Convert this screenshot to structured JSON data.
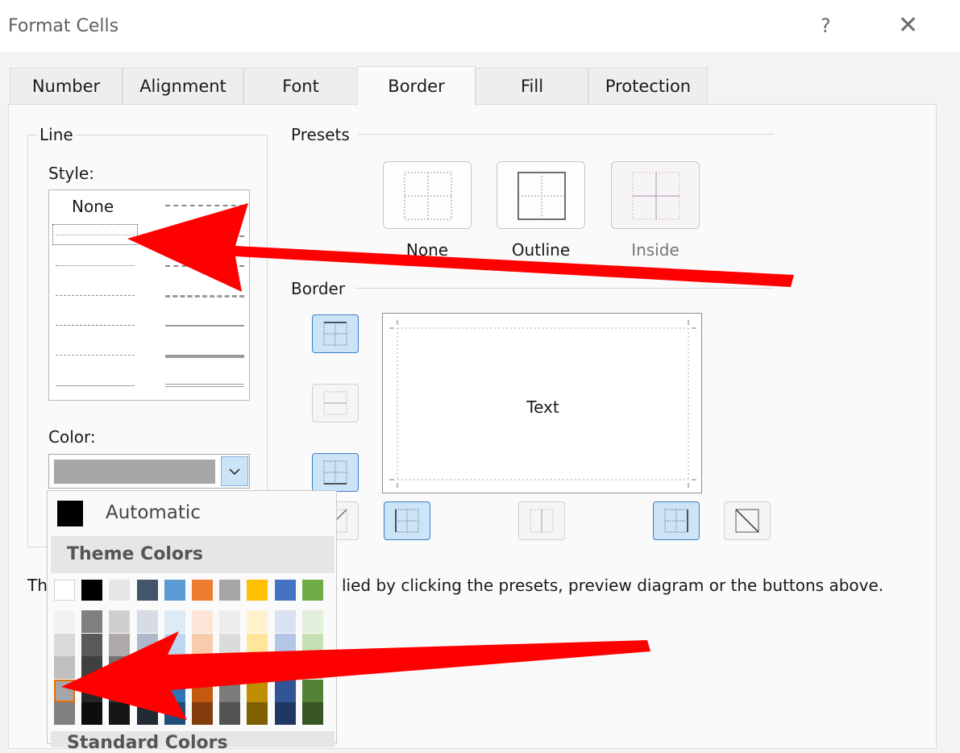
{
  "dialog": {
    "title": "Format Cells",
    "help_label": "?",
    "close_label": "✕"
  },
  "tabs": [
    "Number",
    "Alignment",
    "Font",
    "Border",
    "Fill",
    "Protection"
  ],
  "active_tab": "Border",
  "line": {
    "group_label": "Line",
    "style_label": "Style:",
    "style_none": "None",
    "color_label": "Color:",
    "selected_color": "#A6A6A6"
  },
  "presets": {
    "group_label": "Presets",
    "items": [
      "None",
      "Outline",
      "Inside"
    ]
  },
  "border": {
    "group_label": "Border",
    "preview_text": "Text"
  },
  "hint": {
    "prefix": "Th",
    "suffix": "lied by clicking the presets, preview diagram or the buttons above."
  },
  "palette": {
    "automatic_label": "Automatic",
    "theme_label": "Theme Colors",
    "standard_label": "Standard Colors",
    "top_row": [
      "#FFFFFF",
      "#000000",
      "#E7E6E6",
      "#44546A",
      "#5B9BD5",
      "#ED7D31",
      "#A5A5A5",
      "#FFC000",
      "#4472C4",
      "#70AD47"
    ],
    "shades": [
      [
        "#F2F2F2",
        "#D9D9D9",
        "#BFBFBF",
        "#A6A6A6",
        "#808080"
      ],
      [
        "#808080",
        "#595959",
        "#404040",
        "#262626",
        "#0D0D0D"
      ],
      [
        "#D0CECE",
        "#AEAAAA",
        "#757171",
        "#3A3838",
        "#171616"
      ],
      [
        "#D6DCE4",
        "#ADB9CA",
        "#8497B0",
        "#333F4F",
        "#222A35"
      ],
      [
        "#DDEBF7",
        "#BDD7EE",
        "#9BC2E6",
        "#2F75B5",
        "#1F4E78"
      ],
      [
        "#FCE4D6",
        "#F8CBAD",
        "#F4B084",
        "#C65911",
        "#833C0B"
      ],
      [
        "#EDEDED",
        "#DBDBDB",
        "#C9C9C9",
        "#7B7B7B",
        "#525252"
      ],
      [
        "#FFF2CC",
        "#FFE699",
        "#FFD966",
        "#BF8F00",
        "#7F6000"
      ],
      [
        "#D9E1F2",
        "#B4C6E7",
        "#8EA9DB",
        "#305496",
        "#203764"
      ],
      [
        "#E2EFDA",
        "#C6E0B4",
        "#A9D08E",
        "#548235",
        "#375623"
      ]
    ],
    "selected": {
      "column": 0,
      "row": 3
    }
  },
  "colors": {
    "annotation_arrow": "#FF0000",
    "selection_accent": "#3E7FC1",
    "selected_swatch_border": "#E46C0A"
  }
}
